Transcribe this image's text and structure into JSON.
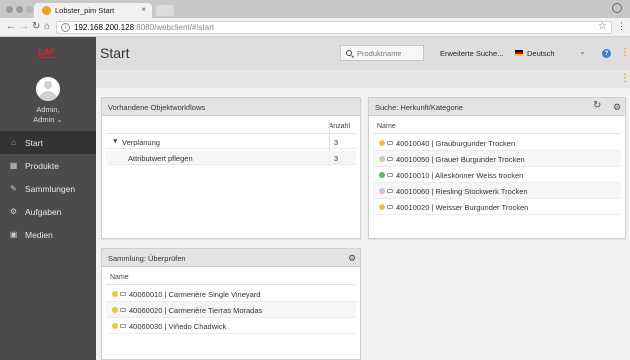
{
  "browser": {
    "tab_title": "Lobster_pim Start",
    "tab_close": "×",
    "url_host": "192.168.200.128",
    "url_rest": ":8080/webclient/#!start",
    "info_glyph": "i",
    "nav_back": "←",
    "nav_forward": "→",
    "nav_reload": "↻",
    "nav_home": "⌂",
    "star_glyph": "☆",
    "menu_glyph": "⋮"
  },
  "sidebar": {
    "logo_text": "LAF",
    "user_name": "Admin,",
    "user_role": "Admin ⌄",
    "items": [
      {
        "label": "Start",
        "icon": "home-icon",
        "glyph": "⌂"
      },
      {
        "label": "Produkte",
        "icon": "grid-icon",
        "glyph": "▦"
      },
      {
        "label": "Sammlungen",
        "icon": "tag-icon",
        "glyph": "✎"
      },
      {
        "label": "Aufgaben",
        "icon": "cogs-icon",
        "glyph": "⚙"
      },
      {
        "label": "Medien",
        "icon": "image-icon",
        "glyph": "▣"
      }
    ]
  },
  "header": {
    "title": "Start",
    "search_placeholder": "Produktname",
    "advanced_search": "Erweiterte Suche...",
    "language": "Deutsch",
    "chevron_glyph": "⌄",
    "help_glyph": "?",
    "menu_glyph": "⋮"
  },
  "workflows": {
    "title": "Vorhandene Objektworkflows",
    "count_header": "Anzahl",
    "caret_glyph": "▼",
    "rows": [
      {
        "label": "Verplanung",
        "count": "3"
      },
      {
        "label": "Attributwert pflegen",
        "count": "3"
      }
    ]
  },
  "search_panel": {
    "title": "Suche: Herkunft/Kategorie",
    "column": "Name",
    "refresh_glyph": "↻",
    "gear_glyph": "⚙",
    "items": [
      {
        "label": "40010040 | Grauburgunder Trocken",
        "status": "#f0c040"
      },
      {
        "label": "40010050 | Grauer Burgunder Trocken",
        "status": "#c8c8c8"
      },
      {
        "label": "40010010 | Alleskönner Weiss trocken",
        "status": "#5cb85c"
      },
      {
        "label": "40010060 | Riesling Stockwerk Trocken",
        "status": "#c8c8c8"
      },
      {
        "label": "40010020 | Weisser Burgunder Trocken",
        "status": "#f0c040"
      }
    ]
  },
  "collection_panel": {
    "title": "Sammlung: Überprüfen",
    "column": "Name",
    "gear_glyph": "⚙",
    "items": [
      {
        "label": "40060010 | Carmenère Single Vineyard",
        "status": "#f0c040"
      },
      {
        "label": "40060020 | Carmenère Tierras Moradas",
        "status": "#f0c040"
      },
      {
        "label": "40060030 | Viñedo Chadwick",
        "status": "#f0c040"
      }
    ]
  },
  "colors": {
    "sidebar_bg": "#4b4b4b",
    "sidebar_active": "#333333",
    "accent_orange": "#f0a020",
    "help_blue": "#3a7bd5"
  }
}
